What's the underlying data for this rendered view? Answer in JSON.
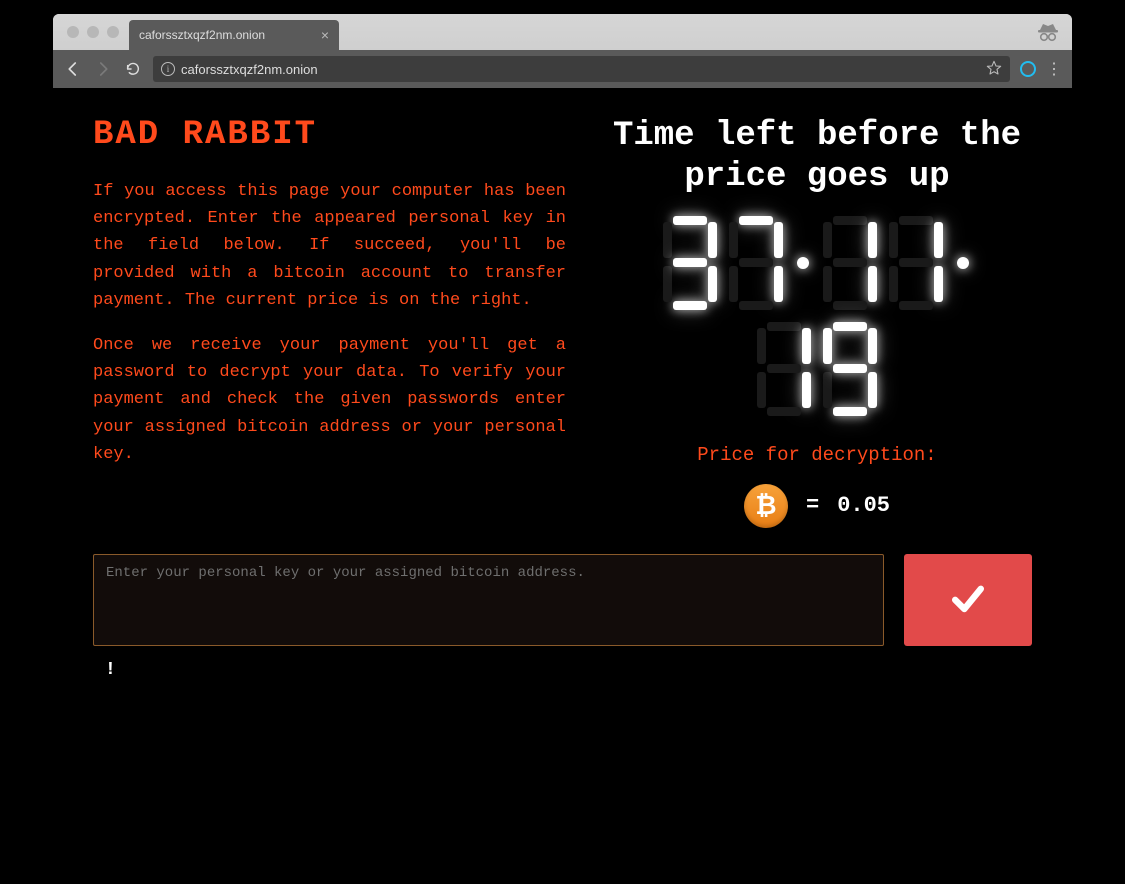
{
  "browser": {
    "tab_title": "caforssztxqzf2nm.onion",
    "url": "caforssztxqzf2nm.onion"
  },
  "page": {
    "title": "BAD RABBIT",
    "para1": "If you access this page your computer has been encrypted. Enter the appeared personal key in the field below. If succeed, you'll be provided with a bitcoin account to transfer payment. The current price is on the right.",
    "para2": "Once we receive your payment you'll get a password to decrypt your data. To verify your payment and check the given passwords enter your assigned bitcoin address or your personal key.",
    "time_header": "Time left before the price goes up",
    "countdown": {
      "hours": "37",
      "minutes": "11",
      "seconds": "19"
    },
    "price_label": "Price for decryption:",
    "price_equals": "=",
    "price_value": "0.05",
    "input_placeholder": "Enter your personal key or your assigned bitcoin address.",
    "status": "!"
  }
}
